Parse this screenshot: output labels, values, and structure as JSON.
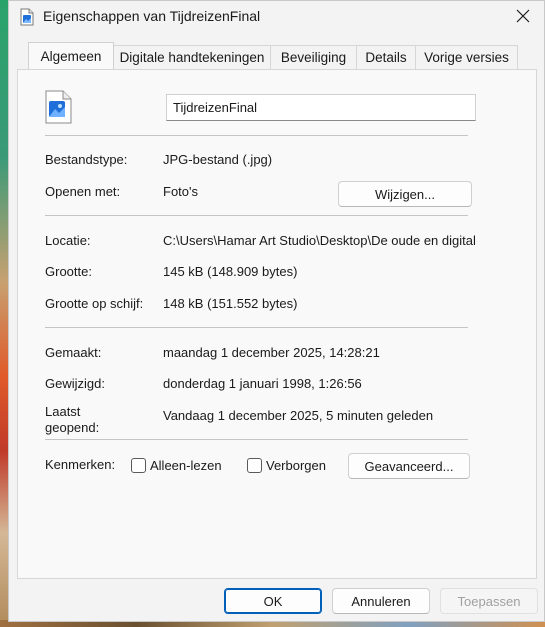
{
  "window": {
    "title": "Eigenschappen van TijdreizenFinal"
  },
  "tabs": [
    {
      "label": "Algemeen",
      "active": true
    },
    {
      "label": "Digitale handtekeningen",
      "active": false
    },
    {
      "label": "Beveiliging",
      "active": false
    },
    {
      "label": "Details",
      "active": false
    },
    {
      "label": "Vorige versies",
      "active": false
    }
  ],
  "general": {
    "file_name": "TijdreizenFinal",
    "file_type_label": "Bestandstype:",
    "file_type_value": "JPG-bestand (.jpg)",
    "open_with_label": "Openen met:",
    "open_with_value": "Foto's",
    "change_button": "Wijzigen...",
    "location_label": "Locatie:",
    "location_value": "C:\\Users\\Hamar Art Studio\\Desktop\\De oude en digitale",
    "size_label": "Grootte:",
    "size_value": "145 kB (148.909 bytes)",
    "size_on_disk_label": "Grootte op schijf:",
    "size_on_disk_value": "148 kB (151.552 bytes)",
    "created_label": "Gemaakt:",
    "created_value": "maandag 1 december 2025, 14:28:21",
    "modified_label": "Gewijzigd:",
    "modified_value": "donderdag 1 januari 1998, 1:26:56",
    "accessed_label_line1": "Laatst",
    "accessed_label_line2": "geopend:",
    "accessed_value": "Vandaag 1 december 2025, 5 minuten geleden",
    "attributes_label": "Kenmerken:",
    "readonly_label": "Alleen-lezen",
    "readonly_checked": false,
    "hidden_label": "Verborgen",
    "hidden_checked": false,
    "advanced_button": "Geavanceerd..."
  },
  "footer": {
    "ok": "OK",
    "cancel": "Annuleren",
    "apply": "Toepassen"
  },
  "icons": {
    "title": "image-file-icon",
    "close": "close-icon",
    "file": "image-file-icon"
  },
  "colors": {
    "accent": "#005fb8",
    "icon_blue": "#1e6fd9"
  }
}
